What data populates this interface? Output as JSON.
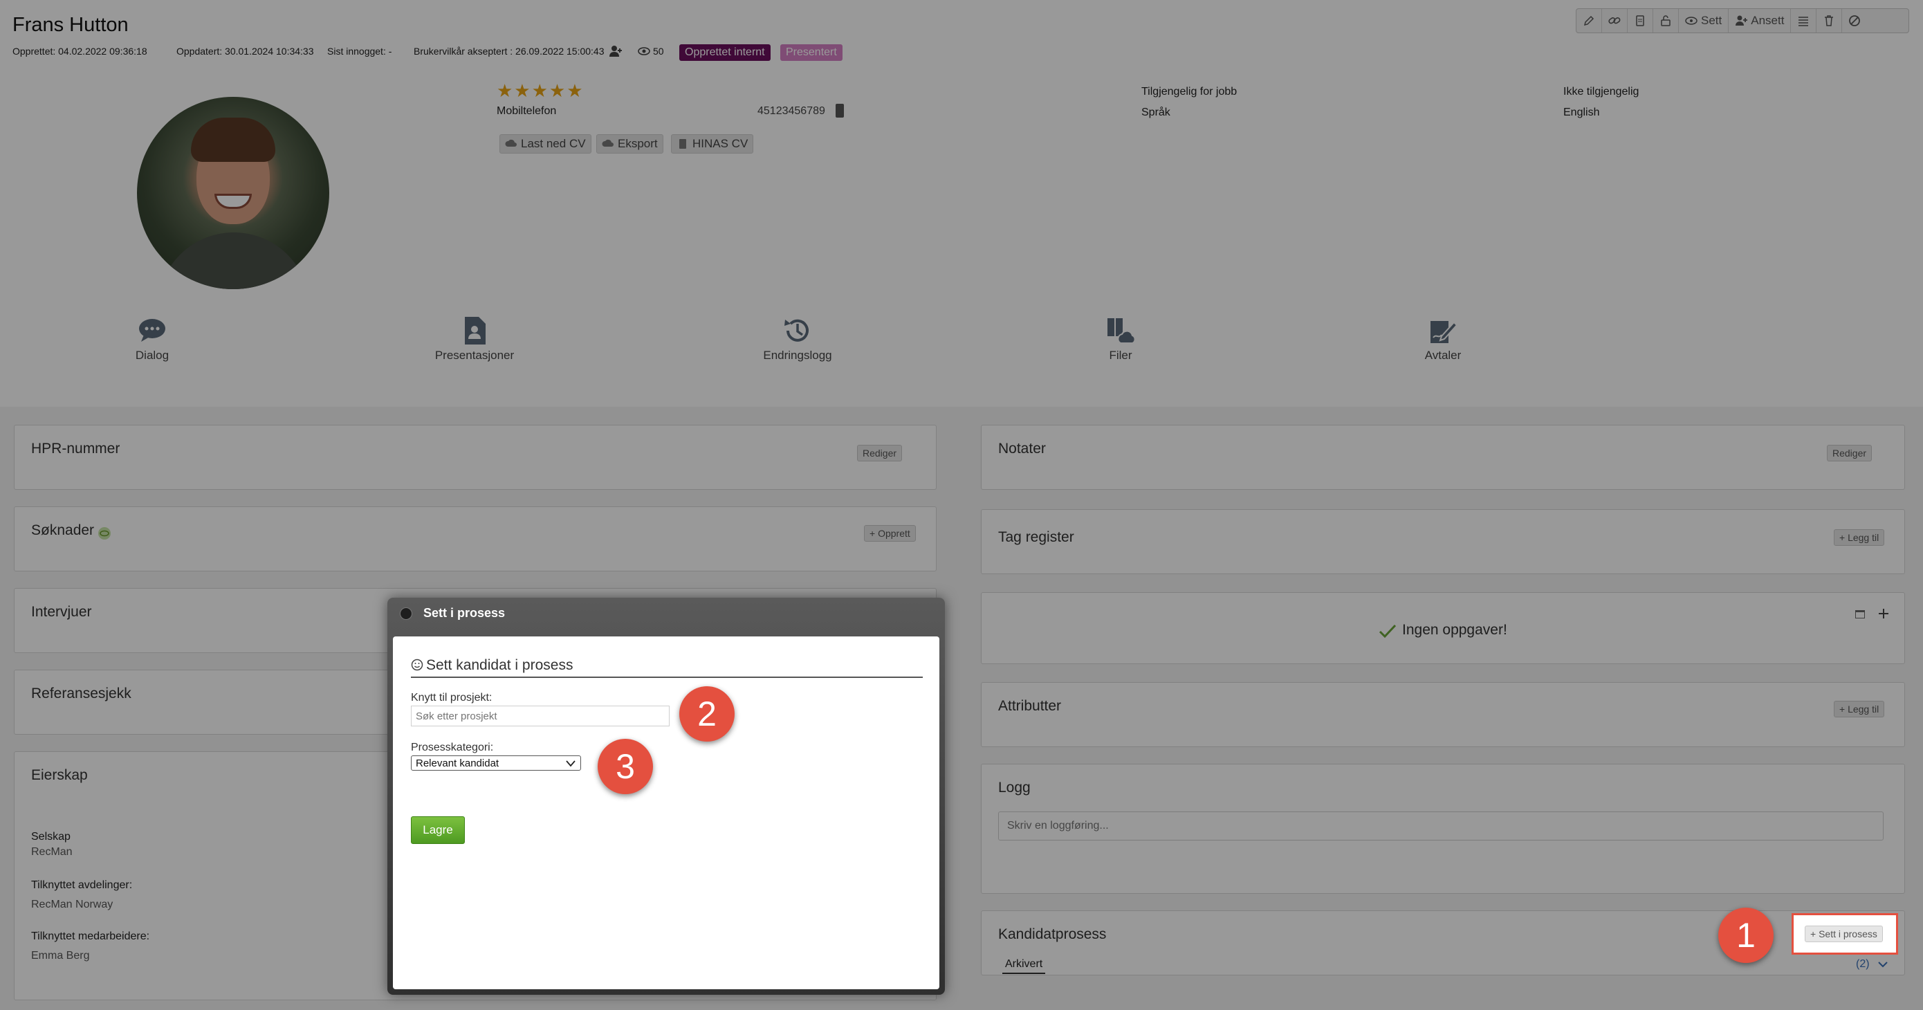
{
  "candidate": {
    "name": "Frans Hutton"
  },
  "meta": {
    "created": "Opprettet: 04.02.2022 09:36:18",
    "updated": "Oppdatert: 30.01.2024 10:34:33",
    "last_login": "Sist innogget: -",
    "terms": "Brukervilkår akseptert : 26.09.2022 15:00:43",
    "views": "50"
  },
  "badges": {
    "internal": "Opprettet internt",
    "presented": "Presentert",
    "internal_color": "#6b0f5e",
    "presented_color": "#d47fc3"
  },
  "toolbar": {
    "seen": "Sett",
    "hire": "Ansett"
  },
  "profile": {
    "rating": 5,
    "stars": "★★★★★",
    "phone_label": "Mobiltelefon",
    "phone_value": "45123456789",
    "available_label": "Tilgjengelig for jobb",
    "available_value": "Ikke tilgjengelig",
    "language_label": "Språk",
    "language_value": "English",
    "download_cv": "Last ned CV",
    "export": "Eksport",
    "hinas_cv": "HINAS CV"
  },
  "nav": {
    "dialog": "Dialog",
    "presentations": "Presentasjoner",
    "changelog": "Endringslogg",
    "files": "Filer",
    "agreements": "Avtaler"
  },
  "left_cards": {
    "hpr": "HPR-nummer",
    "edit": "Rediger",
    "applications": "Søknader",
    "create": "+ Opprett",
    "interviews": "Intervjuer",
    "references": "Referansesjekk",
    "ownership": "Eierskap",
    "company_label": "Selskap",
    "company_value": "RecMan",
    "departments_label": "Tilknyttet avdelinger:",
    "departments_value": "RecMan Norway",
    "staff_label": "Tilknyttet medarbeidere:",
    "staff_value": "Emma Berg"
  },
  "right_cards": {
    "notes": "Notater",
    "edit": "Rediger",
    "tags": "Tag register",
    "add": "+ Legg til",
    "no_tasks": "Ingen oppgaver!",
    "attributes": "Attributter",
    "log": "Logg",
    "log_placeholder": "Skriv en loggføring...",
    "process": "Kandidatprosess",
    "process_btn": "+ Sett i prosess",
    "archived": "Arkivert",
    "count": "(2)"
  },
  "dialog": {
    "title": "Sett i prosess",
    "heading": "Sett kandidat i prosess",
    "project_label": "Knytt til prosjekt:",
    "project_placeholder": "Søk etter prosjekt",
    "category_label": "Prosesskategori:",
    "category_value": "Relevant kandidat",
    "save": "Lagre"
  },
  "markers": {
    "one": "1",
    "two": "2",
    "three": "3",
    "color": "#e4503f"
  }
}
